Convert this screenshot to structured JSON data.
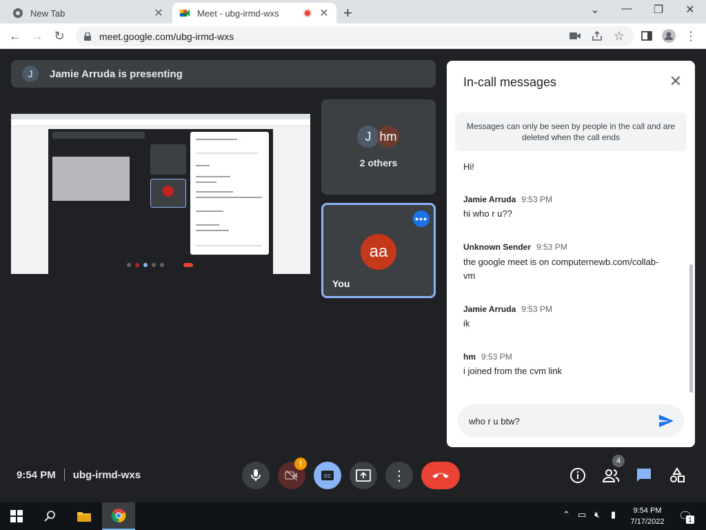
{
  "browser": {
    "tabs": [
      {
        "title": "New Tab",
        "active": false
      },
      {
        "title": "Meet - ubg-irmd-wxs",
        "active": true
      }
    ],
    "url": "meet.google.com/ubg-irmd-wxs"
  },
  "meet": {
    "presenting": {
      "avatar_letter": "J",
      "text": "Jamie Arruda is presenting"
    },
    "tiles": {
      "others": {
        "avatars": [
          "J",
          "hm"
        ],
        "label": "2 others"
      },
      "you": {
        "avatar": "aa",
        "label": "You"
      }
    },
    "bottom": {
      "time": "9:54 PM",
      "meeting_code": "ubg-irmd-wxs",
      "people_count": "4"
    }
  },
  "chat": {
    "title": "In-call messages",
    "notice": "Messages can only be seen by people in the call and are deleted when the call ends",
    "messages": [
      {
        "sender": "",
        "time": "",
        "text": "Hi!"
      },
      {
        "sender": "Jamie Arruda",
        "time": "9:53 PM",
        "text": "hi who r u??"
      },
      {
        "sender": "Unknown Sender",
        "time": "9:53 PM",
        "text": "the google meet is on computernewb.com/collab-vm"
      },
      {
        "sender": "Jamie Arruda",
        "time": "9:53 PM",
        "text": "ik"
      },
      {
        "sender": "hm",
        "time": "9:53 PM",
        "text": "i joined from the cvm link"
      }
    ],
    "input_value": "who r u btw?"
  },
  "taskbar": {
    "time": "9:54 PM",
    "date": "7/17/2022",
    "notifications": "1"
  },
  "colors": {
    "meet_bg": "#202124",
    "accent_blue": "#1a73e8",
    "end_call_red": "#ea4335"
  }
}
